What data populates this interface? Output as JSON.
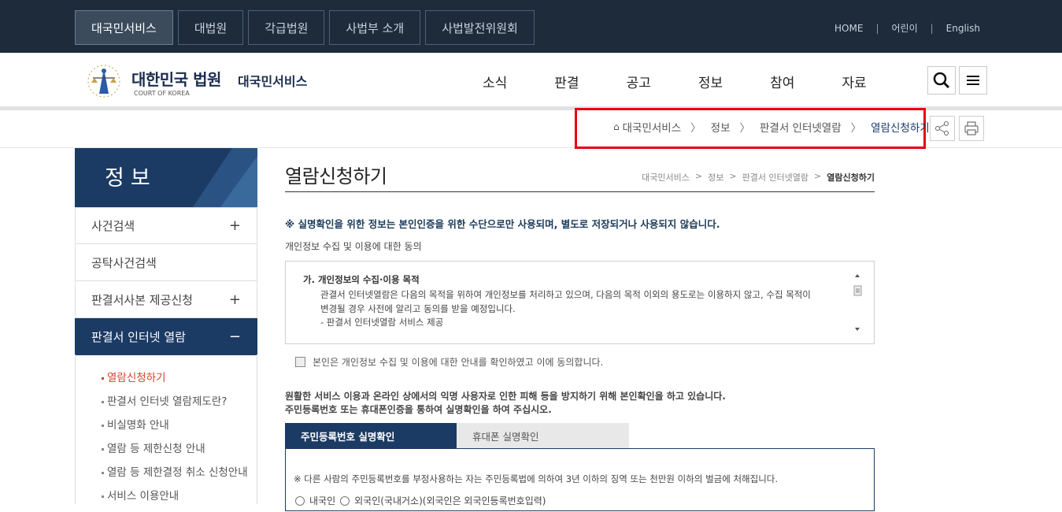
{
  "colors": {
    "topbar": "#1d2b3a",
    "navy": "#1b3b65",
    "highlight": "#e60012",
    "active_sub": "#d2442e"
  },
  "topbar": {
    "tabs": [
      "대국민서비스",
      "대법원",
      "각급법원",
      "사법부 소개",
      "사법발전위원회"
    ],
    "links": [
      "HOME",
      "어린이",
      "English"
    ],
    "sep": "|"
  },
  "header": {
    "brand": "대한민국 법원",
    "brand_sub": "COURT OF KOREA",
    "service": "대국민서비스",
    "gnb": [
      "소식",
      "판결",
      "공고",
      "정보",
      "참여",
      "자료"
    ],
    "search_icon": "search-icon",
    "menu_icon": "hamburger-icon"
  },
  "breadcrumb": {
    "home_icon": "⌂",
    "items": [
      "대국민서비스",
      "정보",
      "판결서 인터넷열람",
      "열람신청하기"
    ],
    "arrow": "〉",
    "share_icon": "share-icon",
    "print_icon": "print-icon"
  },
  "sidebar": {
    "title": "정보",
    "items": [
      {
        "label": "사건검색",
        "pm": "+"
      },
      {
        "label": "공탁사건검색",
        "pm": ""
      },
      {
        "label": "판결서사본 제공신청",
        "pm": "+"
      },
      {
        "label": "판결서 인터넷 열람",
        "pm": "−"
      }
    ],
    "sub": [
      "열람신청하기",
      "판결서 인터넷 열람제도란?",
      "비실명화 안내",
      "열람 등 제한신청 안내",
      "열람 등 제한결정 취소 신청안내",
      "서비스 이용안내"
    ]
  },
  "page": {
    "title": "열람신청하기",
    "crumbs": [
      "대국민서비스",
      "정보",
      "판결서 인터넷열람",
      "열람신청하기"
    ],
    "crumb_arrow": ">",
    "notice": "※ 실명확인을 위한 정보는 본인인증을 위한 수단으로만 사용되며, 별도로 저장되거나 사용되지 않습니다.",
    "consent_label": "개인정보 수집 및 이용에 대한 동의",
    "terms_heading": "가. 개인정보의 수집·이용 목적",
    "terms_body": "관결서 인터넷열람은 다음의 목적을 위하여 개인정보를 처리하고 있으며, 다음의 목적 이외의 용도로는 이용하지 않고, 수집 목적이 변경될 경우 사전에 알리고 동의를 받을 예정입니다.",
    "terms_item": "- 판결서 인터넷열람 서비스 제공",
    "agree_label": "본인은 개인정보 수집 및 이용에 대한 안내를 확인하였고 이에 동의합니다.",
    "desc1": "원활한 서비스 이용과 온라인 상에서의 익명 사용자로 인한 피해 등을 방지하기 위해 본인확인을 하고 있습니다.",
    "desc2": "주민등록번호 또는 휴대폰인증을 통하여 실명확인을 하여 주십시오.",
    "tab_active": "주민등록번호 실명확인",
    "tab_other": "휴대폰 실명확인",
    "warn": "※ 다른 사람의 주민등록번호를 부정사용하는 자는 주민등록법에 의하여 3년 이하의 징역 또는 천만원 이하의 벌금에 처해집니다.",
    "radio1": "내국인",
    "radio2": "외국인(국내거소)(외국인은 외국인등록번호입력)"
  }
}
